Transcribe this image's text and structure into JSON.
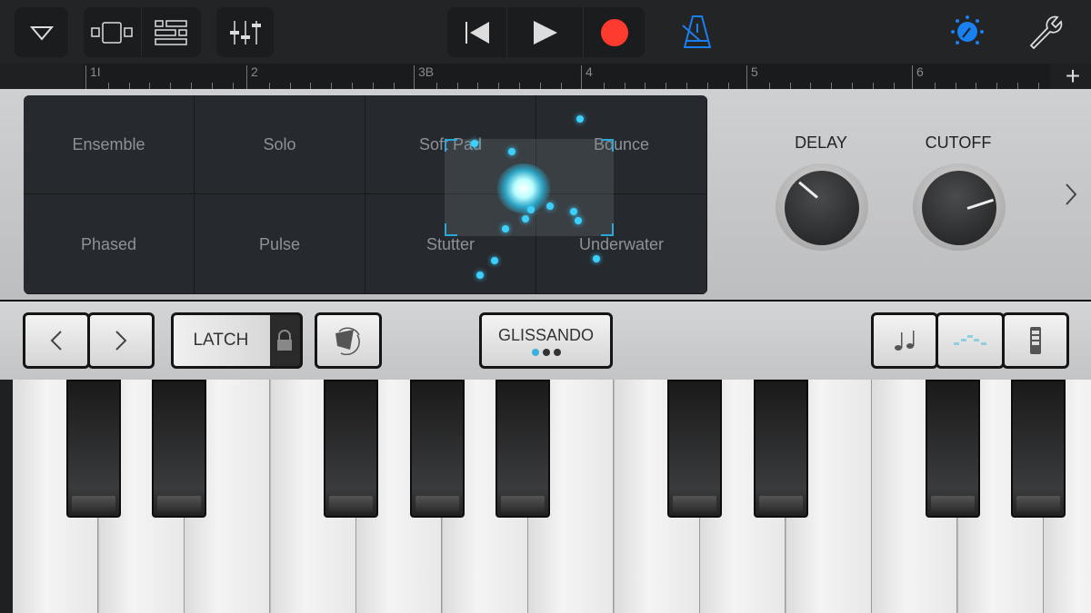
{
  "toolbar": {
    "icons": [
      "browser-triangle-icon",
      "tracks-view-icon",
      "list-view-icon",
      "mixer-icon",
      "rewind-icon",
      "play-icon",
      "record-icon",
      "metronome-icon",
      "master-effects-icon",
      "settings-wrench-icon"
    ],
    "accent": "#1a7ff0",
    "record_color": "#ff3b30"
  },
  "ruler": {
    "bars": [
      "1I",
      "2",
      "3B",
      "4",
      "5",
      "6"
    ],
    "add_label": "+"
  },
  "pad": {
    "cells": [
      "Ensemble",
      "Solo",
      "Soft Pad",
      "Bounce",
      "Phased",
      "Pulse",
      "Stutter",
      "Underwater"
    ]
  },
  "knobs": [
    {
      "label": "DELAY"
    },
    {
      "label": "CUTOFF"
    }
  ],
  "controls": {
    "latch": "LATCH",
    "glissando": "GLISSANDO",
    "glissando_page": 1,
    "glissando_pages": 3
  }
}
